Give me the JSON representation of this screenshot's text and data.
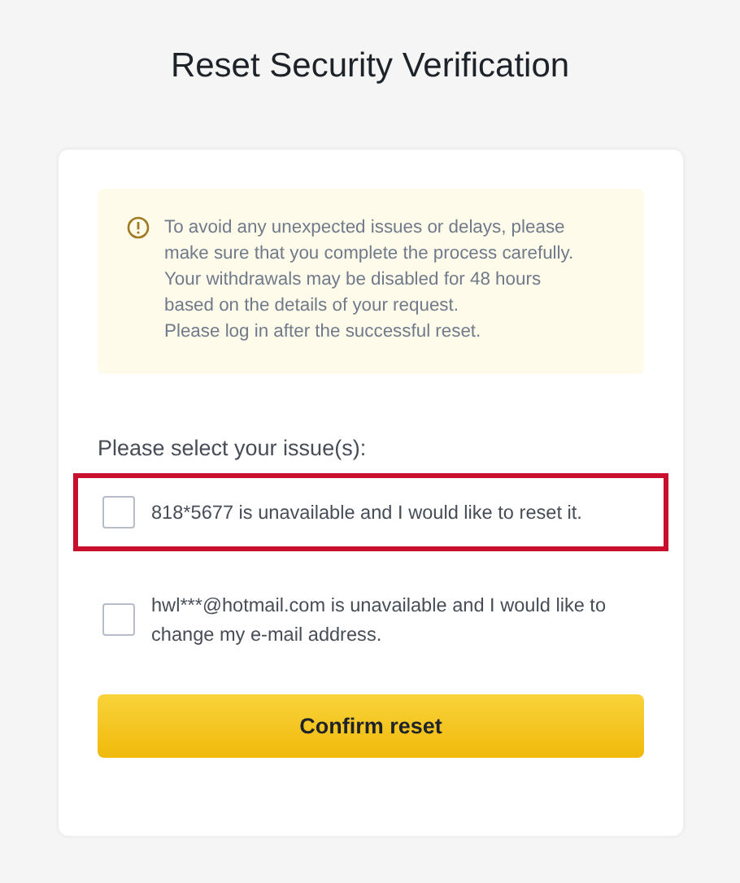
{
  "title": "Reset Security Verification",
  "notice": {
    "text": "To avoid any unexpected issues or delays, please make sure that you complete the process carefully. Your withdrawals may be disabled for 48 hours based on the details of your request.",
    "note": "Please log in after the successful reset."
  },
  "prompt": "Please select your issue(s):",
  "options": [
    {
      "label": "818*5677 is unavailable and I would like to reset it.",
      "checked": false,
      "highlighted": true
    },
    {
      "label": "hwl***@hotmail.com is unavailable and I would like to change my e-mail address.",
      "checked": false,
      "highlighted": false
    }
  ],
  "button": "Confirm reset"
}
